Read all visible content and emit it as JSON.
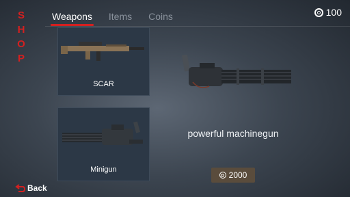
{
  "shop_title": [
    "S",
    "H",
    "O",
    "P"
  ],
  "tabs": [
    {
      "label": "Weapons",
      "active": true
    },
    {
      "label": "Items",
      "active": false
    },
    {
      "label": "Coins",
      "active": false
    }
  ],
  "coins": {
    "amount": "100"
  },
  "weapons": [
    {
      "name": "SCAR"
    },
    {
      "name": "Minigun"
    }
  ],
  "selected": {
    "description": "powerful machinegun",
    "price": "2000"
  },
  "back_label": "Back",
  "colors": {
    "accent_red": "#d42020",
    "card_bg": "#2c3846",
    "price_bg": "#5a4c3c"
  }
}
